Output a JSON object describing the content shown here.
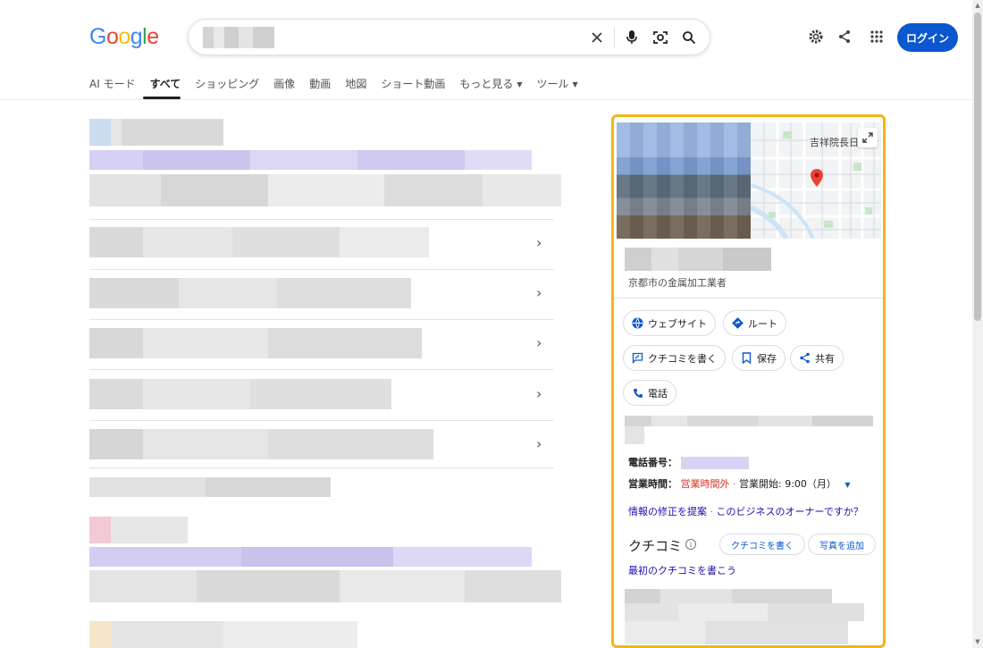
{
  "logo": {
    "text": "Google",
    "letters": [
      "G",
      "o",
      "o",
      "g",
      "l",
      "e"
    ],
    "colors": [
      "#4285f4",
      "#ea4335",
      "#fbbc05",
      "#4285f4",
      "#34a853",
      "#ea4335"
    ]
  },
  "search": {
    "clear_icon": "close-icon",
    "voice_icon": "mic-icon",
    "lens_icon": "camera-lens-icon",
    "search_icon": "search-icon"
  },
  "header": {
    "settings_icon": "gear-icon",
    "share_icon": "share-icon",
    "apps_icon": "apps-grid-icon",
    "login_label": "ログイン",
    "login_color": "#0b57d0"
  },
  "tabs": [
    {
      "label": "AI モード"
    },
    {
      "label": "すべて"
    },
    {
      "label": "ショッピング"
    },
    {
      "label": "画像"
    },
    {
      "label": "動画"
    },
    {
      "label": "地図"
    },
    {
      "label": "ショート動画"
    },
    {
      "label": "もっと見る"
    },
    {
      "label": "ツール"
    }
  ],
  "active_tab": "すべて",
  "panel": {
    "highlight_color": "#f2b614",
    "map_label": "吉祥院長日",
    "subtitle": "京都市の金属加工業者",
    "chips": {
      "website": "ウェブサイト",
      "route": "ルート",
      "write_review": "クチコミを書く",
      "save": "保存",
      "share": "共有",
      "call": "電話"
    },
    "phone_label": "電話番号：",
    "hours_label": "営業時間：",
    "hours_status": "営業時間外",
    "hours_sep": " · ",
    "hours_next": "営業開始: 9:00（月）",
    "suggest_edit": "情報の修正を提案",
    "owner_question": "このビジネスのオーナーですか？",
    "reviews_title": "クチコミ",
    "write_review_btn": "クチコミを書く",
    "add_photo_btn": "写真を追加",
    "first_review_link": "最初のクチコミを書こう"
  }
}
